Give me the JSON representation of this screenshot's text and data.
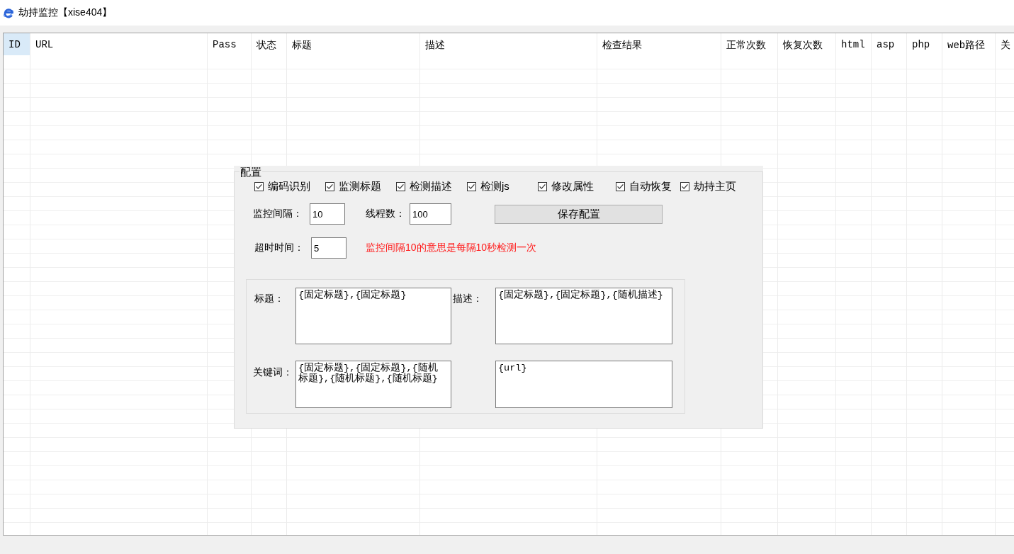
{
  "window": {
    "title": "劫持监控【xise404】"
  },
  "table": {
    "columns": [
      {
        "label": "ID",
        "selected": true
      },
      {
        "label": "URL",
        "selected": false
      },
      {
        "label": "Pass",
        "selected": false
      },
      {
        "label": "状态",
        "selected": false
      },
      {
        "label": "标题",
        "selected": false
      },
      {
        "label": "描述",
        "selected": false
      },
      {
        "label": "检查结果",
        "selected": false
      },
      {
        "label": "正常次数",
        "selected": false
      },
      {
        "label": "恢复次数",
        "selected": false
      },
      {
        "label": "html",
        "selected": false
      },
      {
        "label": "asp",
        "selected": false
      },
      {
        "label": "php",
        "selected": false
      },
      {
        "label": "web路径",
        "selected": false
      },
      {
        "label": "关",
        "selected": false
      }
    ]
  },
  "config": {
    "title": "配置",
    "options": [
      {
        "label": "编码识别",
        "checked": true
      },
      {
        "label": "监测标题",
        "checked": true
      },
      {
        "label": "检测描述",
        "checked": true
      },
      {
        "label": "检测js",
        "checked": true
      },
      {
        "label": "修改属性",
        "checked": true
      },
      {
        "label": "自动恢复",
        "checked": true
      },
      {
        "label": "劫持主页",
        "checked": true
      }
    ],
    "fields": [
      {
        "label": "监控间隔：",
        "value": "10"
      },
      {
        "label": "线程数：",
        "value": "100"
      }
    ],
    "save_button": "保存配置",
    "timeout": {
      "label": "超时时间：",
      "value": "5"
    },
    "note": "监控间隔10的意思是每隔10秒检测一次",
    "templates": [
      {
        "label": "标题：",
        "value": "{固定标题},{固定标题}"
      },
      {
        "label": "描述：",
        "value": "{固定标题},{固定标题},{随机描述}"
      },
      {
        "label": "关键词：",
        "value": "{固定标题},{固定标题},{随机标题},{随机标题},{随机标题}"
      },
      {
        "value": "{url}"
      }
    ]
  }
}
